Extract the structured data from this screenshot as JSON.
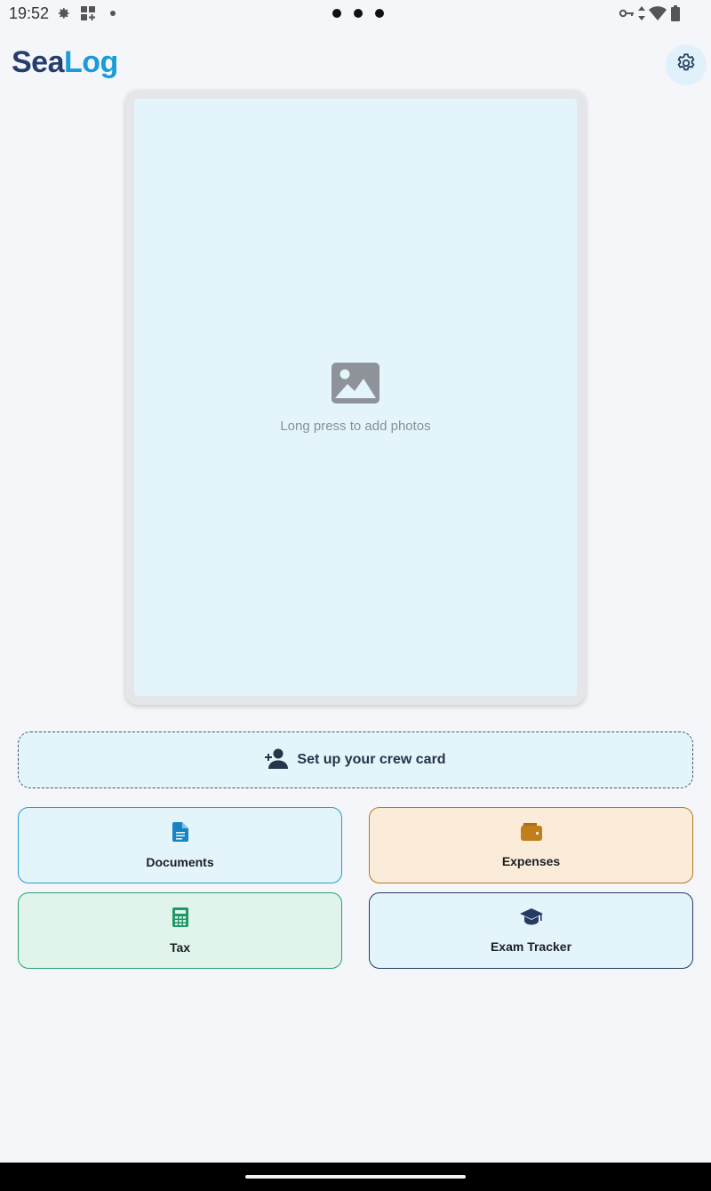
{
  "status_bar": {
    "time": "19:52",
    "icons": [
      "settings-gear-icon",
      "grid-add-icon",
      "notification-dot-icon",
      "vpn-key-icon",
      "data-arrows-icon",
      "wifi-icon",
      "battery-icon"
    ]
  },
  "header": {
    "logo_part_1": "Sea",
    "logo_part_2": "Log",
    "settings_icon": "gear-icon"
  },
  "photo_card": {
    "icon": "image-icon",
    "hint": "Long press to add photos"
  },
  "crew_card": {
    "icon": "person-add-icon",
    "label": "Set up your crew card"
  },
  "tiles": [
    {
      "label": "Documents",
      "icon": "document-icon",
      "color": "#1f9fd4"
    },
    {
      "label": "Expenses",
      "icon": "wallet-icon",
      "color": "#b77820"
    },
    {
      "label": "Tax",
      "icon": "calculator-icon",
      "color": "#2aa06f"
    },
    {
      "label": "Exam Tracker",
      "icon": "graduation-cap-icon",
      "color": "#273a63"
    }
  ],
  "colors": {
    "brand_dark": "#263e6e",
    "brand_light": "#1a9cd8",
    "background": "#f4f6f9"
  }
}
